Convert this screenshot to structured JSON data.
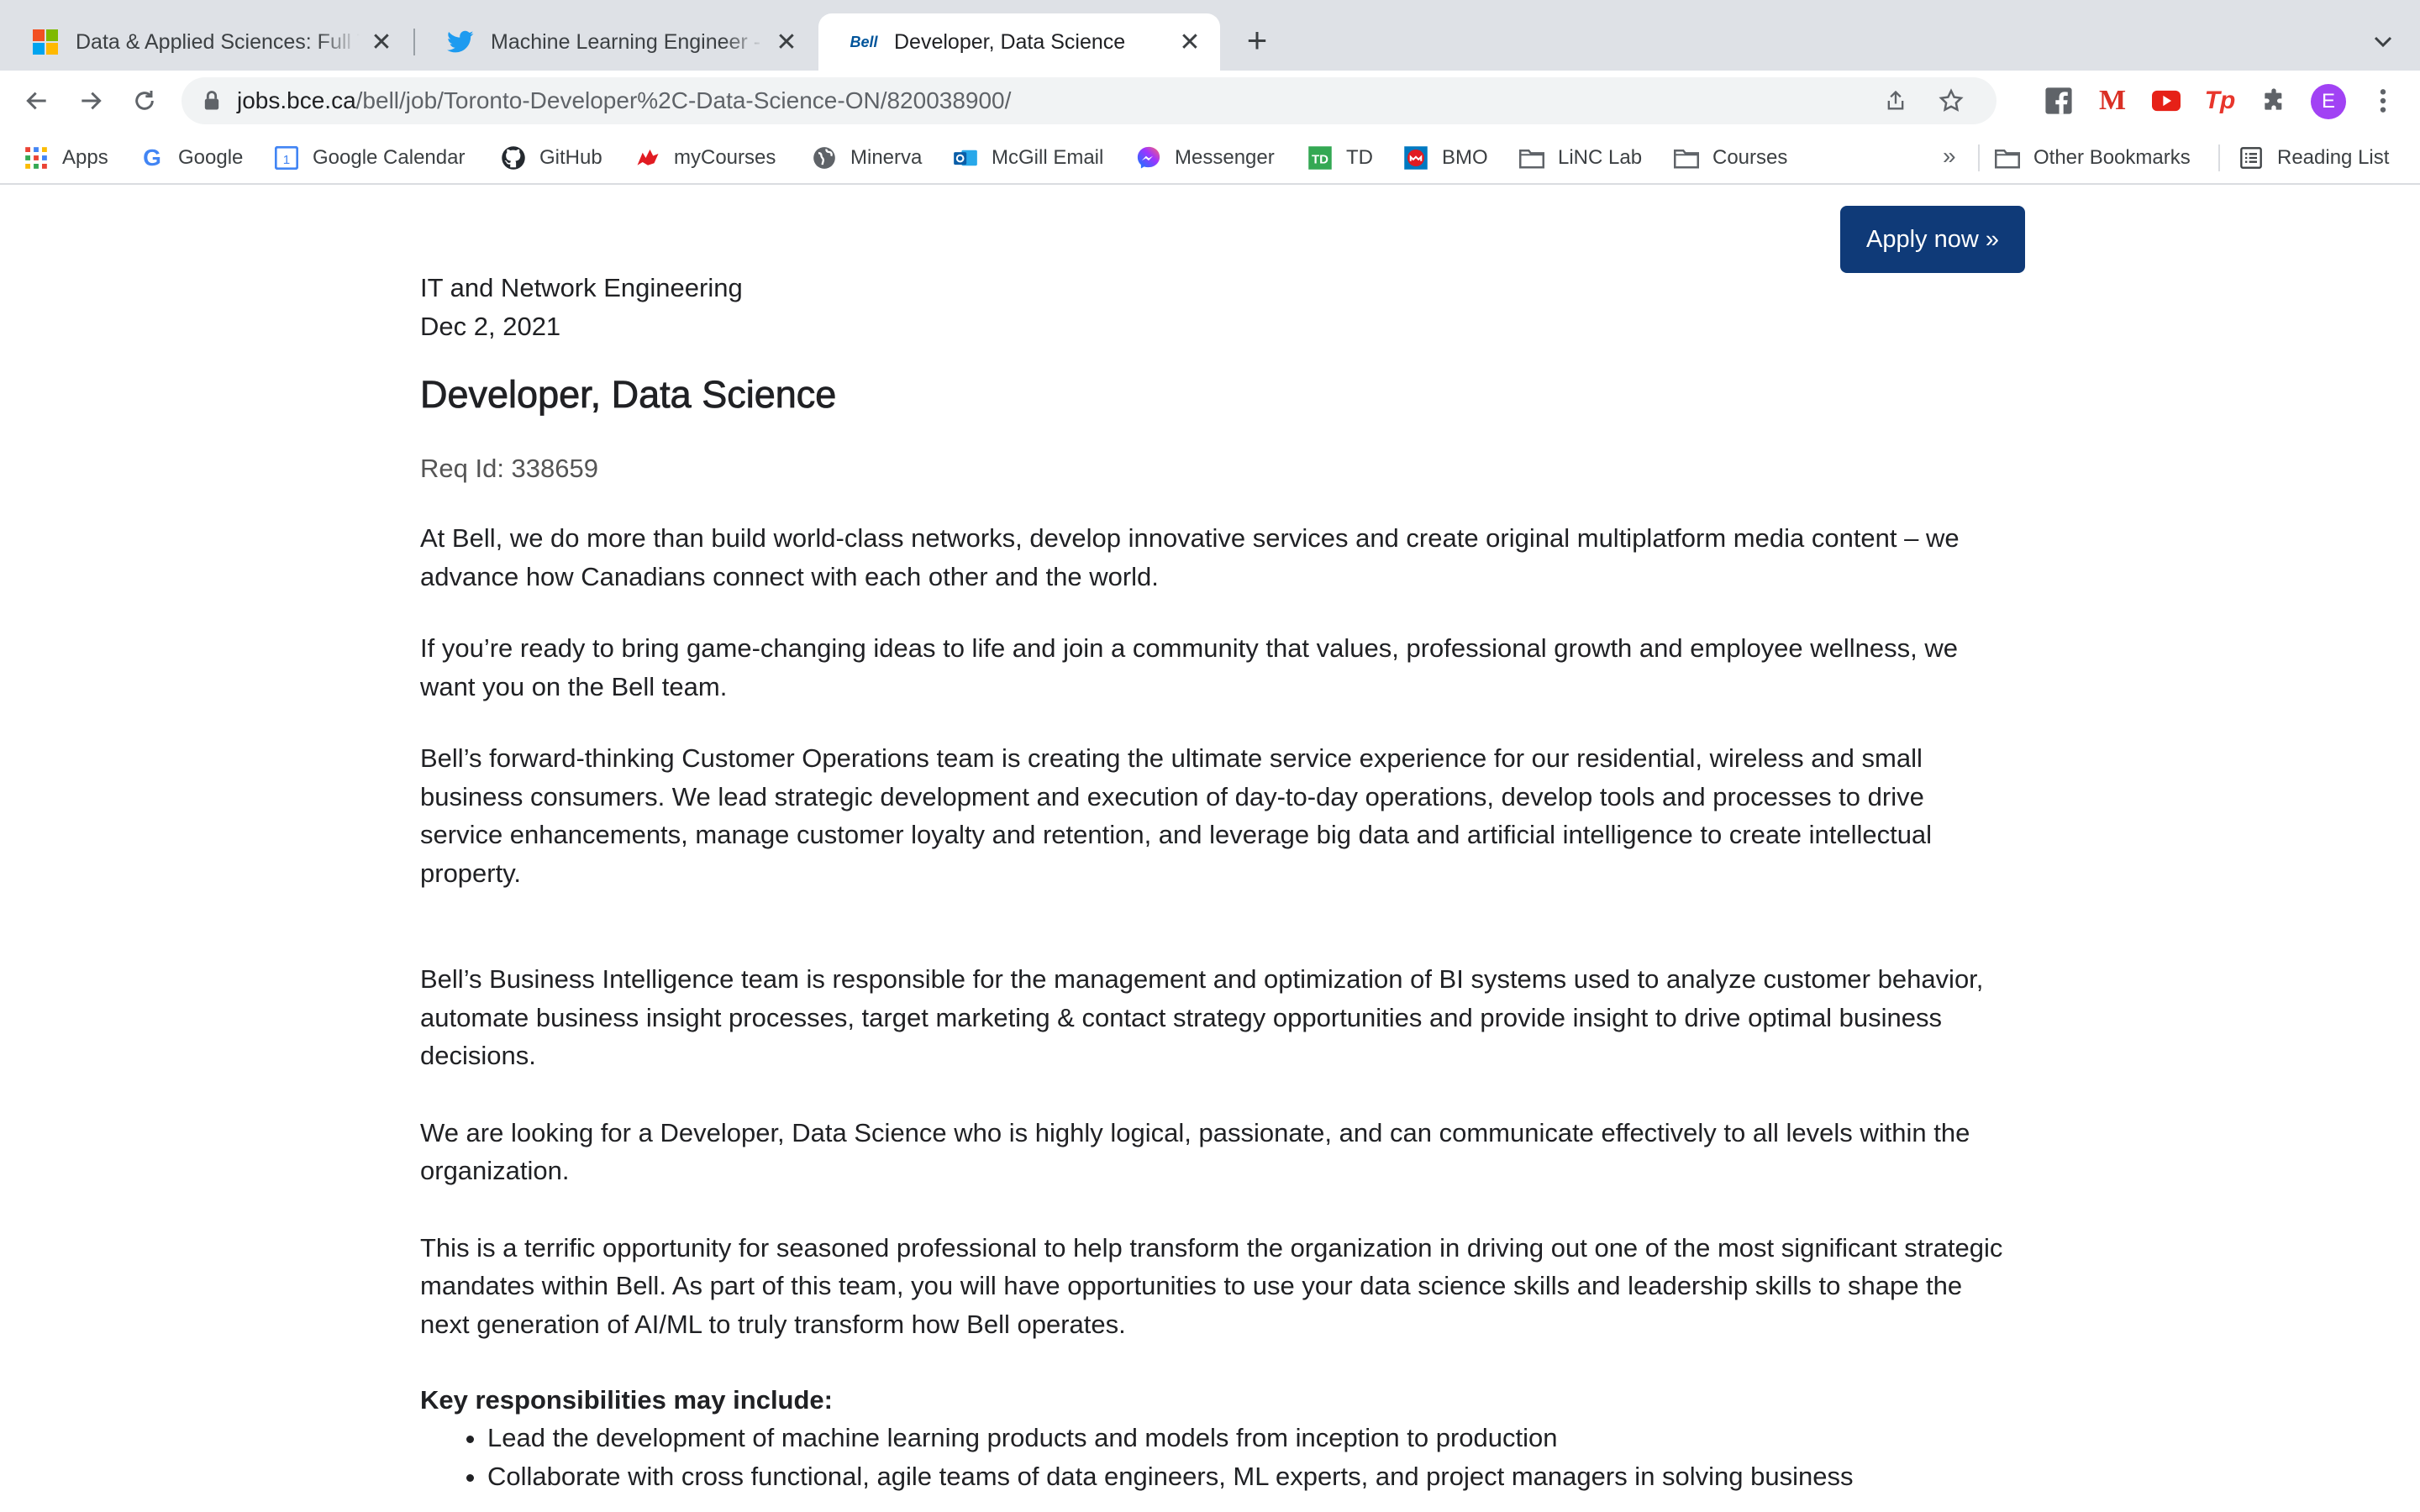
{
  "tabs": [
    {
      "title": "Data & Applied Sciences: Full Time Opportunities",
      "icon": "microsoft-icon"
    },
    {
      "title": "Machine Learning Engineer - Undergraduate",
      "icon": "twitter-icon"
    },
    {
      "title": "Developer, Data Science",
      "icon": "bell-icon",
      "favicon_text": "Bell"
    }
  ],
  "toolbar": {
    "url_host": "jobs.bce.ca",
    "url_path": "/bell/job/Toronto-Developer%2C-Data-Science-ON/820038900/",
    "avatar_letter": "E"
  },
  "bookmarks": [
    {
      "label": "Apps",
      "icon": "apps-grid-icon"
    },
    {
      "label": "Google",
      "icon": "google-icon"
    },
    {
      "label": "Google Calendar",
      "icon": "calendar-icon"
    },
    {
      "label": "GitHub",
      "icon": "github-icon"
    },
    {
      "label": "myCourses",
      "icon": "mcgill-icon"
    },
    {
      "label": "Minerva",
      "icon": "globe-icon"
    },
    {
      "label": "McGill Email",
      "icon": "outlook-icon"
    },
    {
      "label": "Messenger",
      "icon": "messenger-icon"
    },
    {
      "label": "TD",
      "icon": "td-icon"
    },
    {
      "label": "BMO",
      "icon": "bmo-icon"
    },
    {
      "label": "LiNC Lab",
      "icon": "folder-icon"
    },
    {
      "label": "Courses",
      "icon": "folder-icon"
    }
  ],
  "bookmarks_right": {
    "overflow": "»",
    "other": "Other Bookmarks",
    "reading_list": "Reading List"
  },
  "page": {
    "apply_label": "Apply now »",
    "department": "IT and Network Engineering",
    "date": "Dec 2, 2021",
    "title": "Developer, Data Science",
    "req_id": "Req Id: 338659",
    "paragraphs": [
      "At Bell, we do more than build world-class networks, develop innovative services and create original multiplatform media content – we advance how Canadians connect with each other and the world.",
      "If you’re ready to bring game-changing ideas to life and join a community that values, professional growth and employee wellness, we want you on the Bell team.",
      "Bell’s forward-thinking Customer Operations team is creating the ultimate service experience for our residential, wireless and small business consumers. We lead strategic development and execution of day-to-day operations, develop tools and processes to drive service enhancements, manage customer loyalty and retention, and leverage big data and artificial intelligence to create intellectual property.",
      "Bell’s Business Intelligence team is responsible for the management and optimization of BI systems used to analyze customer behavior, automate business insight processes, target marketing & contact strategy opportunities and provide insight to drive optimal business decisions.",
      "We are looking for a Developer, Data Science who is highly logical, passionate, and can communicate effectively to all levels within the organization.",
      "This is a terrific opportunity for seasoned professional to help transform the organization in driving out one of the most significant strategic mandates within Bell. As part of this team, you will have opportunities to use your data science skills and leadership skills to shape the next generation of AI/ML to truly transform how Bell operates."
    ],
    "responsibilities_heading": "Key responsibilities may include:",
    "responsibilities": [
      "Lead the development of machine learning products and models from inception to production",
      "Collaborate with cross functional, agile teams of data engineers, ML experts, and project managers in solving business"
    ]
  },
  "colors": {
    "apply_button": "#0f3a78",
    "tabstrip": "#dee1e6",
    "avatar": "#a142f4"
  }
}
